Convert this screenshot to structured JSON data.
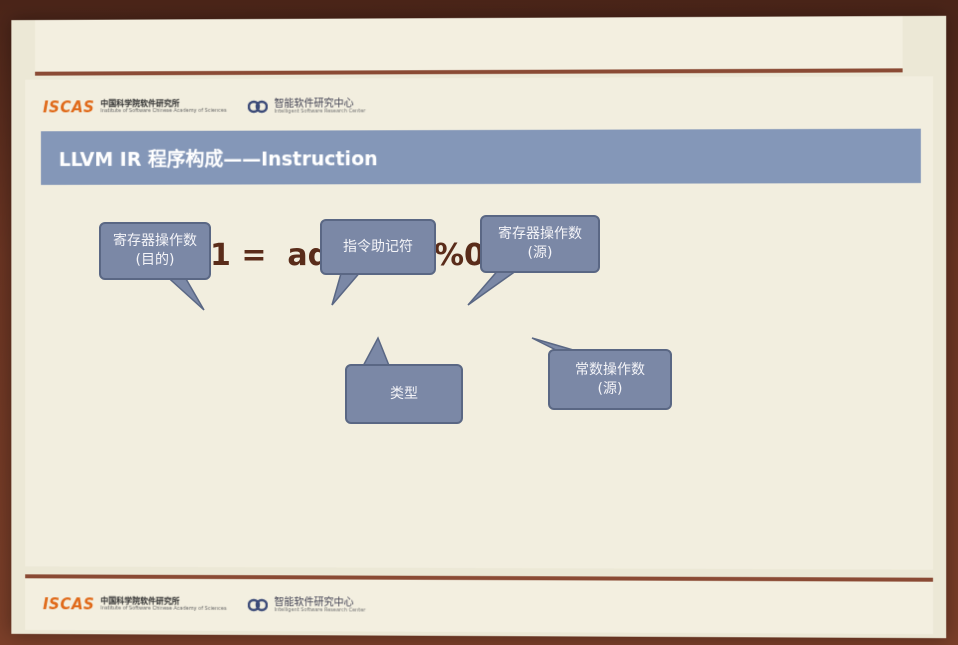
{
  "header": {
    "iscas_mark": "ISCAS",
    "iscas_cn": "中国科学院软件研究所",
    "iscas_en": "Institute of Software Chinese Academy of Sciences",
    "isrc_cn": "智能软件研究中心",
    "isrc_en": "Intelligent Software Research Center"
  },
  "slide": {
    "title": "LLVM IR 程序构成——Instruction",
    "instruction_line": "%1 =  add i32  %0,  1",
    "bubbles": {
      "dest_register": {
        "line1": "寄存器操作数",
        "line2": "(目的)"
      },
      "mnemonic": {
        "line1": "指令助记符"
      },
      "src_register": {
        "line1": "寄存器操作数",
        "line2": "(源)"
      },
      "type": {
        "line1": "类型"
      },
      "const_operand": {
        "line1": "常数操作数",
        "line2": "(源)"
      }
    }
  },
  "footer": {
    "iscas_mark": "ISCAS",
    "iscas_cn": "中国科学院软件研究所",
    "iscas_en": "Institute of Software Chinese Academy of Sciences",
    "isrc_cn": "智能软件研究中心",
    "isrc_en": "Intelligent Software Research Center"
  },
  "colors": {
    "title_bar": "#8497b8",
    "bubble_fill": "#7b88a6",
    "instruction_text": "#5a2c1a",
    "iscas_orange": "#e06a1a"
  }
}
